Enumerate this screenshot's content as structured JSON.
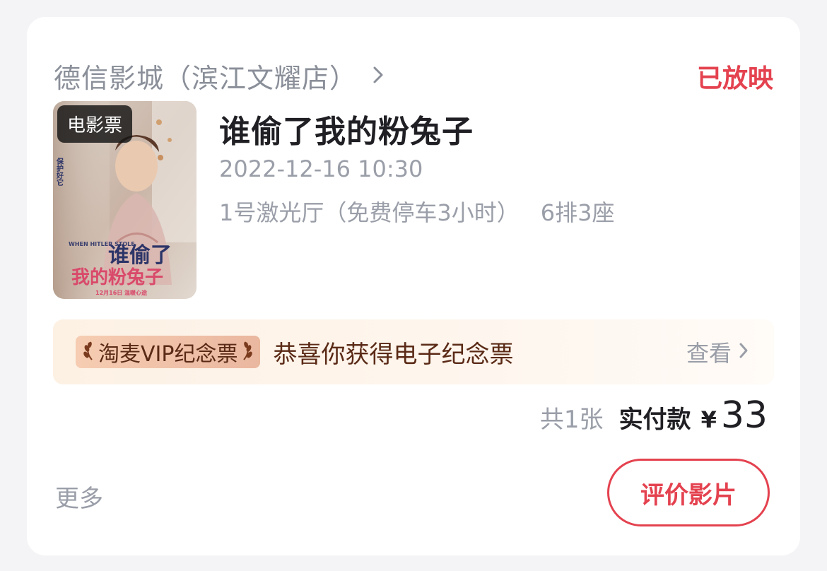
{
  "order": {
    "cinema_name": "德信影城（滨江文耀店）",
    "status": "已放映",
    "poster": {
      "badge": "电影票",
      "title_line1": "谁偷了",
      "title_line2": "我的粉兔子",
      "english_title": "WHEN HITLER STOLE",
      "release_note": "12月16日 温暖心途",
      "tagline": "保护好它"
    },
    "movie_title": "谁偷了我的粉兔子",
    "showtime": "2022-12-16 10:30",
    "hall": "1号激光厅（免费停车3小时）",
    "seats": "6排3座"
  },
  "vip": {
    "tag": "淘麦VIP纪念票",
    "message": "恭喜你获得电子纪念票",
    "view_label": "查看"
  },
  "summary": {
    "count": "共1张",
    "paid_label": "实付款",
    "currency": "¥",
    "amount": "33"
  },
  "actions": {
    "more_label": "更多",
    "review_label": "评价影片"
  },
  "colors": {
    "accent": "#e4424f",
    "muted_text": "#9a9ea8",
    "vip_text": "#5a2a16"
  }
}
